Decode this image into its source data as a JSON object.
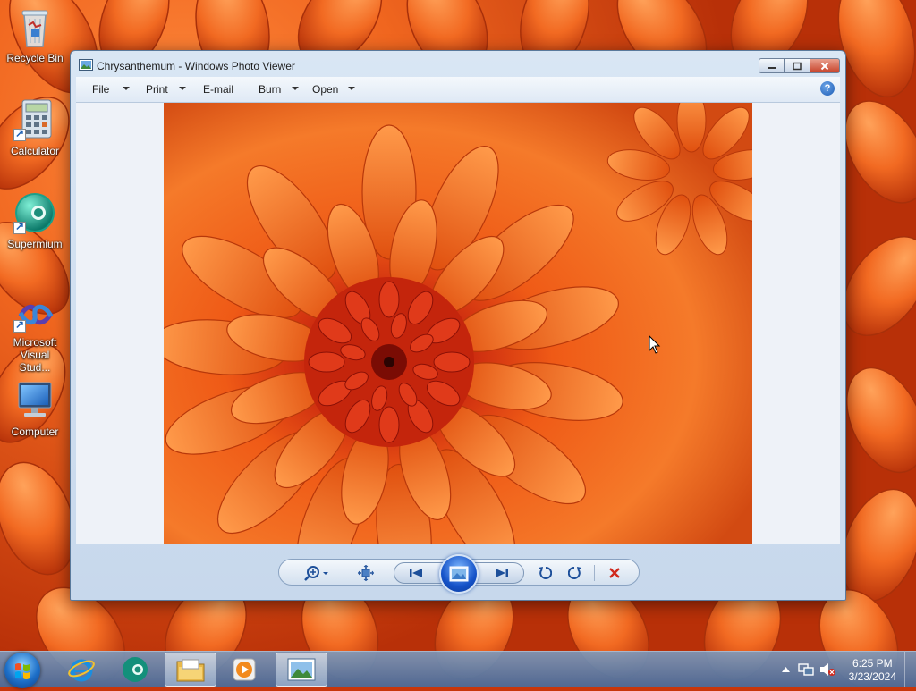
{
  "desktop": {
    "icons": [
      {
        "label": "Recycle Bin",
        "icon": "recycle-bin-icon"
      },
      {
        "label": "Calculator",
        "icon": "calculator-icon"
      },
      {
        "label": "Supermium",
        "icon": "supermium-icon"
      },
      {
        "label": "Microsoft Visual Stud...",
        "icon": "visual-studio-icon"
      },
      {
        "label": "Computer",
        "icon": "computer-icon"
      }
    ]
  },
  "window": {
    "title": "Chrysanthemum - Windows Photo Viewer",
    "menu": {
      "file": "File",
      "print": "Print",
      "email": "E-mail",
      "burn": "Burn",
      "open": "Open",
      "help": "?"
    }
  },
  "colors": {
    "accent": "#1d5cb5",
    "close_red": "#c7432a",
    "delete_red": "#d0281c",
    "petal_orange": "#f0661f"
  },
  "taskbar": {
    "apps": [
      "internet-explorer-icon",
      "supermium-icon",
      "file-explorer-icon",
      "media-player-icon",
      "photo-viewer-icon"
    ],
    "clock": {
      "time": "6:25 PM",
      "date": "3/23/2024"
    }
  }
}
